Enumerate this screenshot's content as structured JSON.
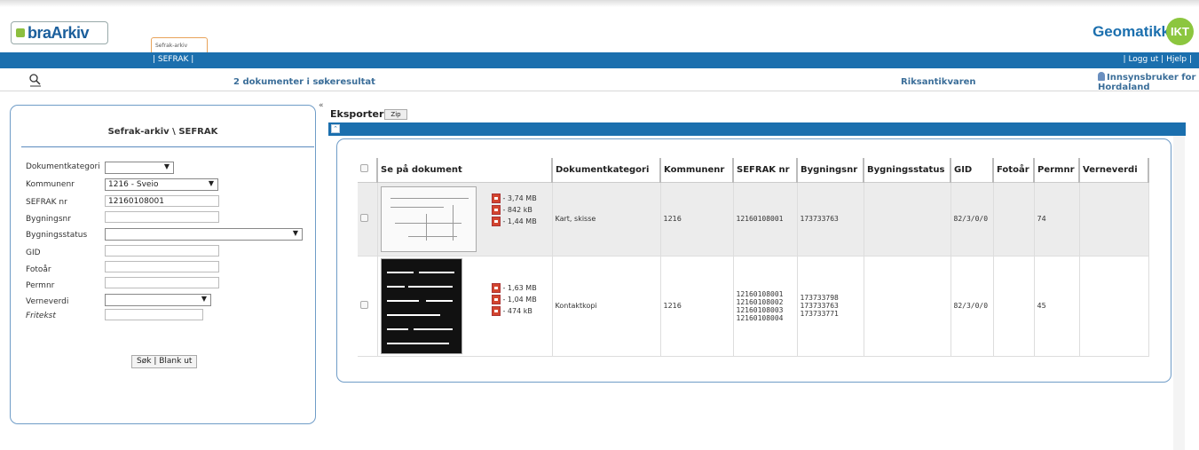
{
  "header": {
    "logo_text": "braArkiv",
    "app_tab": "Sefrak-arkiv",
    "brand": "Geomatikk",
    "brand_badge": "IKT",
    "nav_left": "| SEFRAK |",
    "nav_right": "| Logg ut | Hjelp |"
  },
  "infobar": {
    "result": "2 dokumenter i søkeresultat",
    "agency": "Riksantikvaren",
    "user": "Innsynsbruker for Hordaland"
  },
  "search_panel": {
    "title": "Sefrak-arkiv \\ SEFRAK",
    "fields": {
      "dokumentkategori": {
        "label": "Dokumentkategori",
        "value": ""
      },
      "kommunenr": {
        "label": "Kommunenr",
        "value": "1216 - Sveio"
      },
      "sefrak_nr": {
        "label": "SEFRAK nr",
        "value": "12160108001"
      },
      "bygningsnr": {
        "label": "Bygningsnr",
        "value": ""
      },
      "bygningsstatus": {
        "label": "Bygningsstatus",
        "value": ""
      },
      "gid": {
        "label": "GID",
        "value": ""
      },
      "fotoar": {
        "label": "Fotoår",
        "value": ""
      },
      "permnr": {
        "label": "Permnr",
        "value": ""
      },
      "verneverdi": {
        "label": "Verneverdi",
        "value": ""
      },
      "fritekst": {
        "label": "Fritekst",
        "value": ""
      }
    },
    "search_button": "Søk",
    "separator": "|",
    "clear_button": "Blank ut"
  },
  "toolbar": {
    "export_label": "Eksporter",
    "zip_button": "Zip"
  },
  "table": {
    "columns": [
      "Se på dokument",
      "Dokumentkategori",
      "Kommunenr",
      "SEFRAK nr",
      "Bygningsnr",
      "Bygningsstatus",
      "GID",
      "Fotoår",
      "Permnr",
      "Verneverdi"
    ],
    "rows": [
      {
        "files": [
          "- 3,74 MB",
          "- 842 kB",
          "- 1,44 MB"
        ],
        "dokumentkategori": "Kart, skisse",
        "kommunenr": "1216",
        "sefrak_nr": [
          "12160108001"
        ],
        "bygningsnr": [
          "173733763"
        ],
        "bygningsstatus": "",
        "gid": "82/3/0/0",
        "fotoar": "",
        "permnr": "74",
        "verneverdi": ""
      },
      {
        "files": [
          "- 1,63 MB",
          "- 1,04 MB",
          "- 474 kB"
        ],
        "dokumentkategori": "Kontaktkopi",
        "kommunenr": "1216",
        "sefrak_nr": [
          "12160108001",
          "12160108002",
          "12160108003",
          "12160108004"
        ],
        "bygningsnr": [
          "173733798",
          "173733763",
          "173733771"
        ],
        "bygningsstatus": "",
        "gid": "82/3/0/0",
        "fotoar": "",
        "permnr": "45",
        "verneverdi": ""
      }
    ]
  },
  "icons": {
    "search": "magnifier-document-icon",
    "user": "person-icon",
    "pdf": "pdf-file-icon",
    "collapse": "double-chevron-left-icon",
    "expand": "double-chevron-up-icon"
  },
  "colors": {
    "primary_blue": "#1b6fae",
    "brand_green": "#8cc63f",
    "panel_border": "#6f9cc7"
  }
}
